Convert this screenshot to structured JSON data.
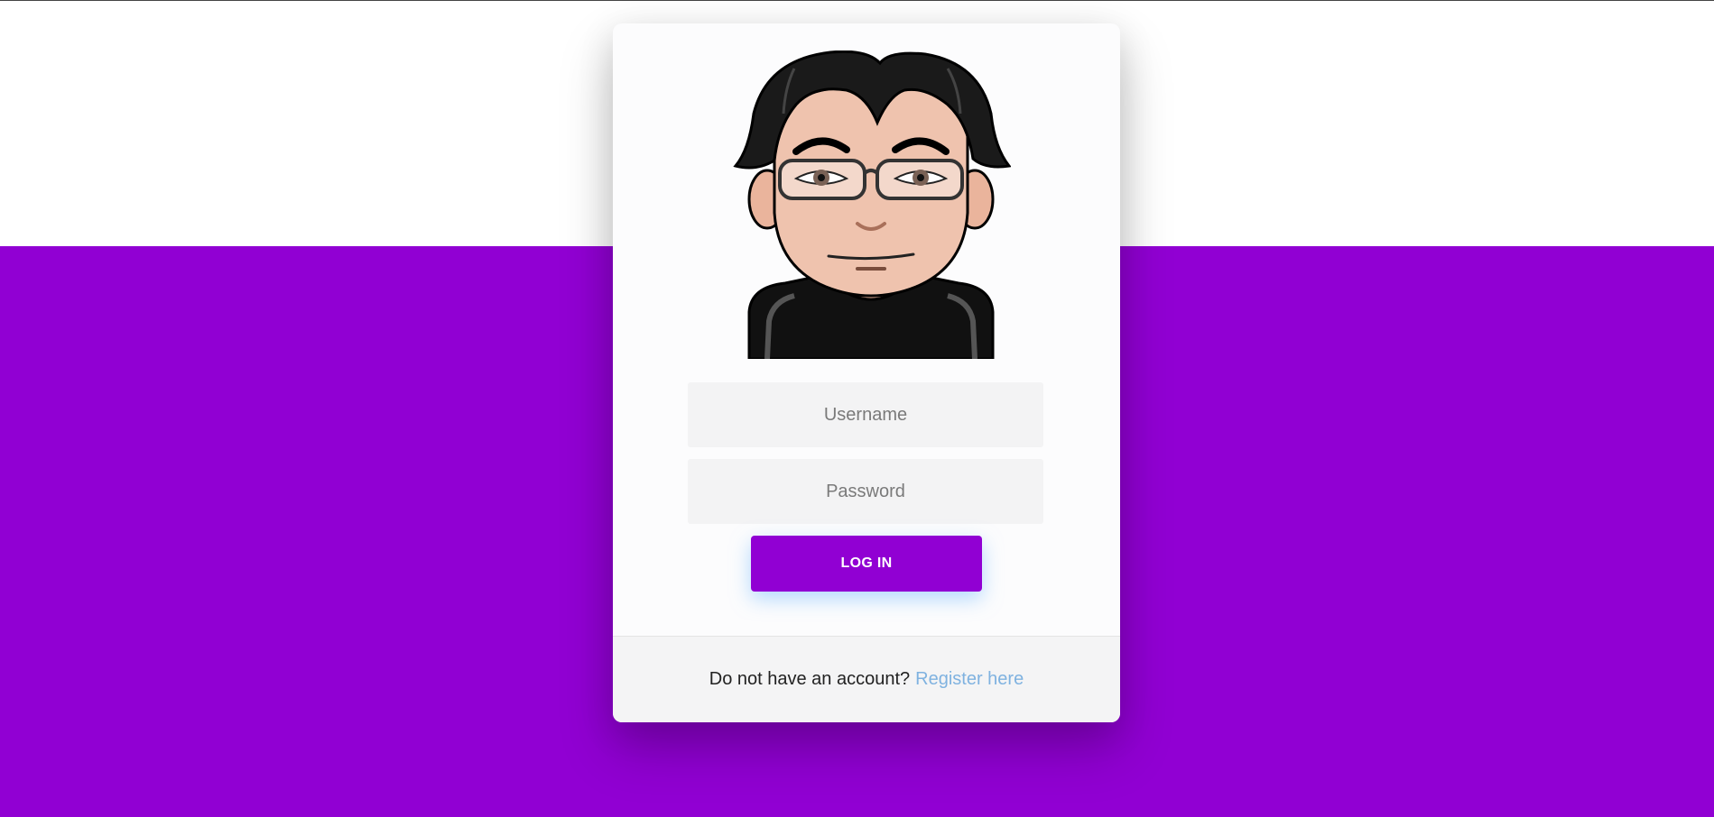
{
  "login_form": {
    "username_placeholder": "Username",
    "password_placeholder": "Password",
    "login_label": "LOG IN"
  },
  "footer": {
    "prompt": "Do not have an account?",
    "register_link": "Register here"
  },
  "colors": {
    "brand_purple": "#9100d3",
    "link_blue": "#7fb2e0"
  },
  "avatar": {
    "icon": "cartoon-avatar-man-with-glasses"
  }
}
